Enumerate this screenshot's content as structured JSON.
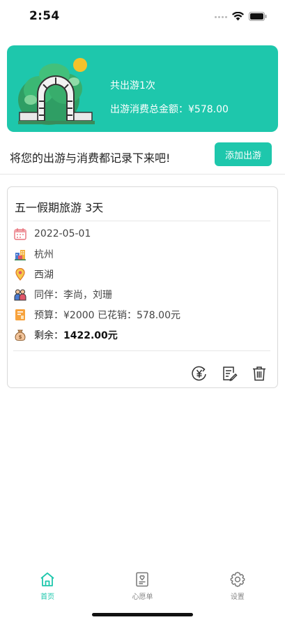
{
  "status": {
    "time": "2:54"
  },
  "summary": {
    "count_text": "共出游1次",
    "total_text": "出游消费总金额：¥578.00"
  },
  "prompt": {
    "text": "将您的出游与消费都记录下来吧!",
    "add_button": "添加出游"
  },
  "trip": {
    "title": "五一假期旅游 3天",
    "date": "2022-05-01",
    "city": "杭州",
    "place": "西湖",
    "companions": "同伴：李尚，刘珊",
    "budget": "预算：¥2000  已花销：578.00元",
    "remaining_label": "剩余：",
    "remaining_value": "1422.00元"
  },
  "tabs": [
    {
      "label": "首页"
    },
    {
      "label": "心愿单"
    },
    {
      "label": "设置"
    }
  ],
  "colors": {
    "accent": "#1ec7ac"
  }
}
